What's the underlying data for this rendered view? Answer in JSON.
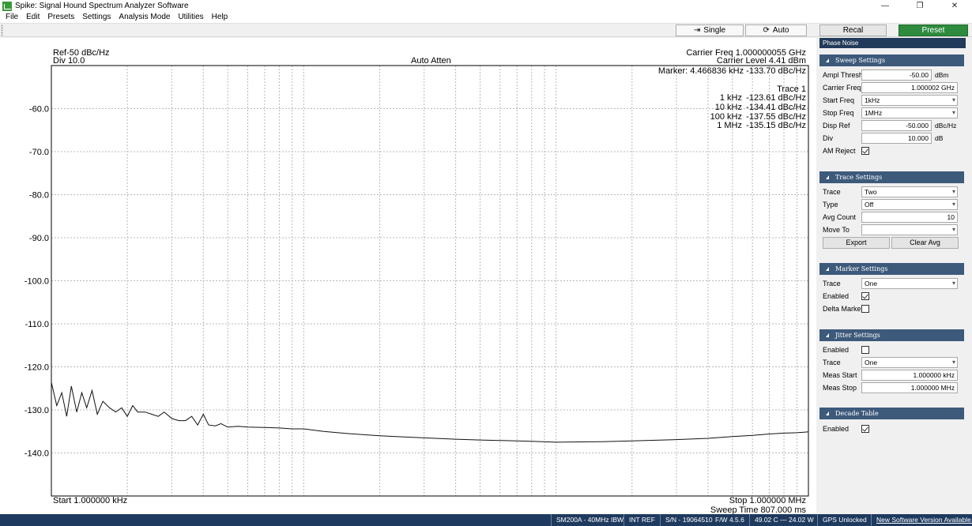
{
  "window": {
    "title": "Spike: Signal Hound Spectrum Analyzer Software",
    "controls": {
      "minimize": "—",
      "restore": "❐",
      "close": "✕"
    }
  },
  "menu": [
    "File",
    "Edit",
    "Presets",
    "Settings",
    "Analysis Mode",
    "Utilities",
    "Help"
  ],
  "toolbar": {
    "single_label": "Single",
    "auto_label": "Auto",
    "recal_label": "Recal",
    "preset_label": "Preset"
  },
  "plot": {
    "ref": "Ref-50 dBc/Hz",
    "div": "Div 10.0",
    "auto_atten": "Auto Atten",
    "carrier_freq": "Carrier Freq 1.000000055 GHz",
    "carrier_level": "Carrier Level 4.41 dBm",
    "marker": "Marker: 4.466836 kHz -133.70 dBc/Hz",
    "trace_title": "Trace 1",
    "decades": [
      {
        "freq": "1 kHz",
        "value": "-123.61 dBc/Hz"
      },
      {
        "freq": "10 kHz",
        "value": "-134.41 dBc/Hz"
      },
      {
        "freq": "100 kHz",
        "value": "-137.55 dBc/Hz"
      },
      {
        "freq": "1 MHz",
        "value": "-135.15 dBc/Hz"
      }
    ],
    "start": "Start 1.000000 kHz",
    "stop": "Stop 1.000000 MHz",
    "sweep_time": "Sweep Time 807.000 ms",
    "y_ticks": [
      "-60.0",
      "-70.0",
      "-80.0",
      "-90.0",
      "-100.0",
      "-110.0",
      "-120.0",
      "-130.0",
      "-140.0"
    ]
  },
  "chart_data": {
    "type": "line",
    "x_scale": "log",
    "x_unit": "Hz",
    "xlim": [
      1000,
      1000000
    ],
    "ylim": [
      -150,
      -50
    ],
    "grid": true,
    "ylabel": "",
    "xlabel": "",
    "series": [
      {
        "x": [
          1000,
          1050,
          1100,
          1150,
          1200,
          1260,
          1320,
          1380,
          1450,
          1520,
          1600,
          1700,
          1800,
          1900,
          2000,
          2100,
          2200,
          2350,
          2500,
          2650,
          2800,
          3000,
          3200,
          3400,
          3600,
          3800,
          4000,
          4200,
          4467,
          4700,
          5000,
          5500,
          6000,
          7000,
          8000,
          9000,
          10000,
          12000,
          15000,
          20000,
          25000,
          30000,
          40000,
          50000,
          60000,
          70000,
          80000,
          100000,
          150000,
          200000,
          300000,
          400000,
          500000,
          600000,
          700000,
          800000,
          900000,
          1000000
        ],
        "y": [
          -123.6,
          -129.0,
          -126.0,
          -131.5,
          -124.5,
          -130.5,
          -126.0,
          -129.5,
          -125.5,
          -131.0,
          -128.0,
          -129.5,
          -130.5,
          -129.5,
          -131.5,
          -129.0,
          -130.5,
          -130.5,
          -131.0,
          -131.5,
          -130.5,
          -132.0,
          -132.5,
          -132.5,
          -131.5,
          -133.5,
          -131.0,
          -133.5,
          -133.7,
          -133.2,
          -134.0,
          -133.8,
          -134.0,
          -134.1,
          -134.2,
          -134.4,
          -134.4,
          -135.0,
          -135.5,
          -136.0,
          -136.3,
          -136.5,
          -136.8,
          -137.0,
          -137.1,
          -137.2,
          -137.3,
          -137.5,
          -137.4,
          -137.2,
          -136.9,
          -136.6,
          -136.2,
          -135.9,
          -135.6,
          -135.4,
          -135.3,
          -135.1
        ]
      }
    ]
  },
  "panel": {
    "tab": "Phase Noise",
    "sweep": {
      "header": "Sweep Settings",
      "ampl_thresh_label": "Ampl Thresh",
      "ampl_thresh": "-50.00",
      "ampl_thresh_unit": "dBm",
      "carrier_freq_label": "Carrier Freq",
      "carrier_freq": "1.000002 GHz",
      "start_freq_label": "Start Freq",
      "start_freq": "1kHz",
      "stop_freq_label": "Stop Freq",
      "stop_freq": "1MHz",
      "disp_ref_label": "Disp Ref",
      "disp_ref": "-50.000",
      "disp_ref_unit": "dBc/Hz",
      "div_label": "Div",
      "div": "10.000",
      "div_unit": "dB",
      "am_reject_label": "AM Reject",
      "am_reject": true
    },
    "trace": {
      "header": "Trace Settings",
      "trace_label": "Trace",
      "trace": "Two",
      "type_label": "Type",
      "type": "Off",
      "avg_count_label": "Avg Count",
      "avg_count": "10",
      "move_to_label": "Move To",
      "move_to": "",
      "export_label": "Export",
      "clear_avg_label": "Clear Avg"
    },
    "marker": {
      "header": "Marker Settings",
      "trace_label": "Trace",
      "trace": "One",
      "enabled_label": "Enabled",
      "enabled": true,
      "delta_label": "Delta Marker",
      "delta": false
    },
    "jitter": {
      "header": "Jitter Settings",
      "enabled_label": "Enabled",
      "enabled": false,
      "trace_label": "Trace",
      "trace": "One",
      "meas_start_label": "Meas Start",
      "meas_start": "1.000000 kHz",
      "meas_stop_label": "Meas Stop",
      "meas_stop": "1.000000 MHz"
    },
    "decade": {
      "header": "Decade Table",
      "enabled_label": "Enabled",
      "enabled": true
    }
  },
  "status": {
    "device": "SM200A - 40MHz IBW",
    "ref": "INT REF",
    "serial": "S/N - 19064510",
    "firmware": "F/W 4.5.6",
    "temp_power": "49.02 C  —  24.02 W",
    "gps": "GPS Unlocked",
    "update": "New Software Version Available."
  }
}
